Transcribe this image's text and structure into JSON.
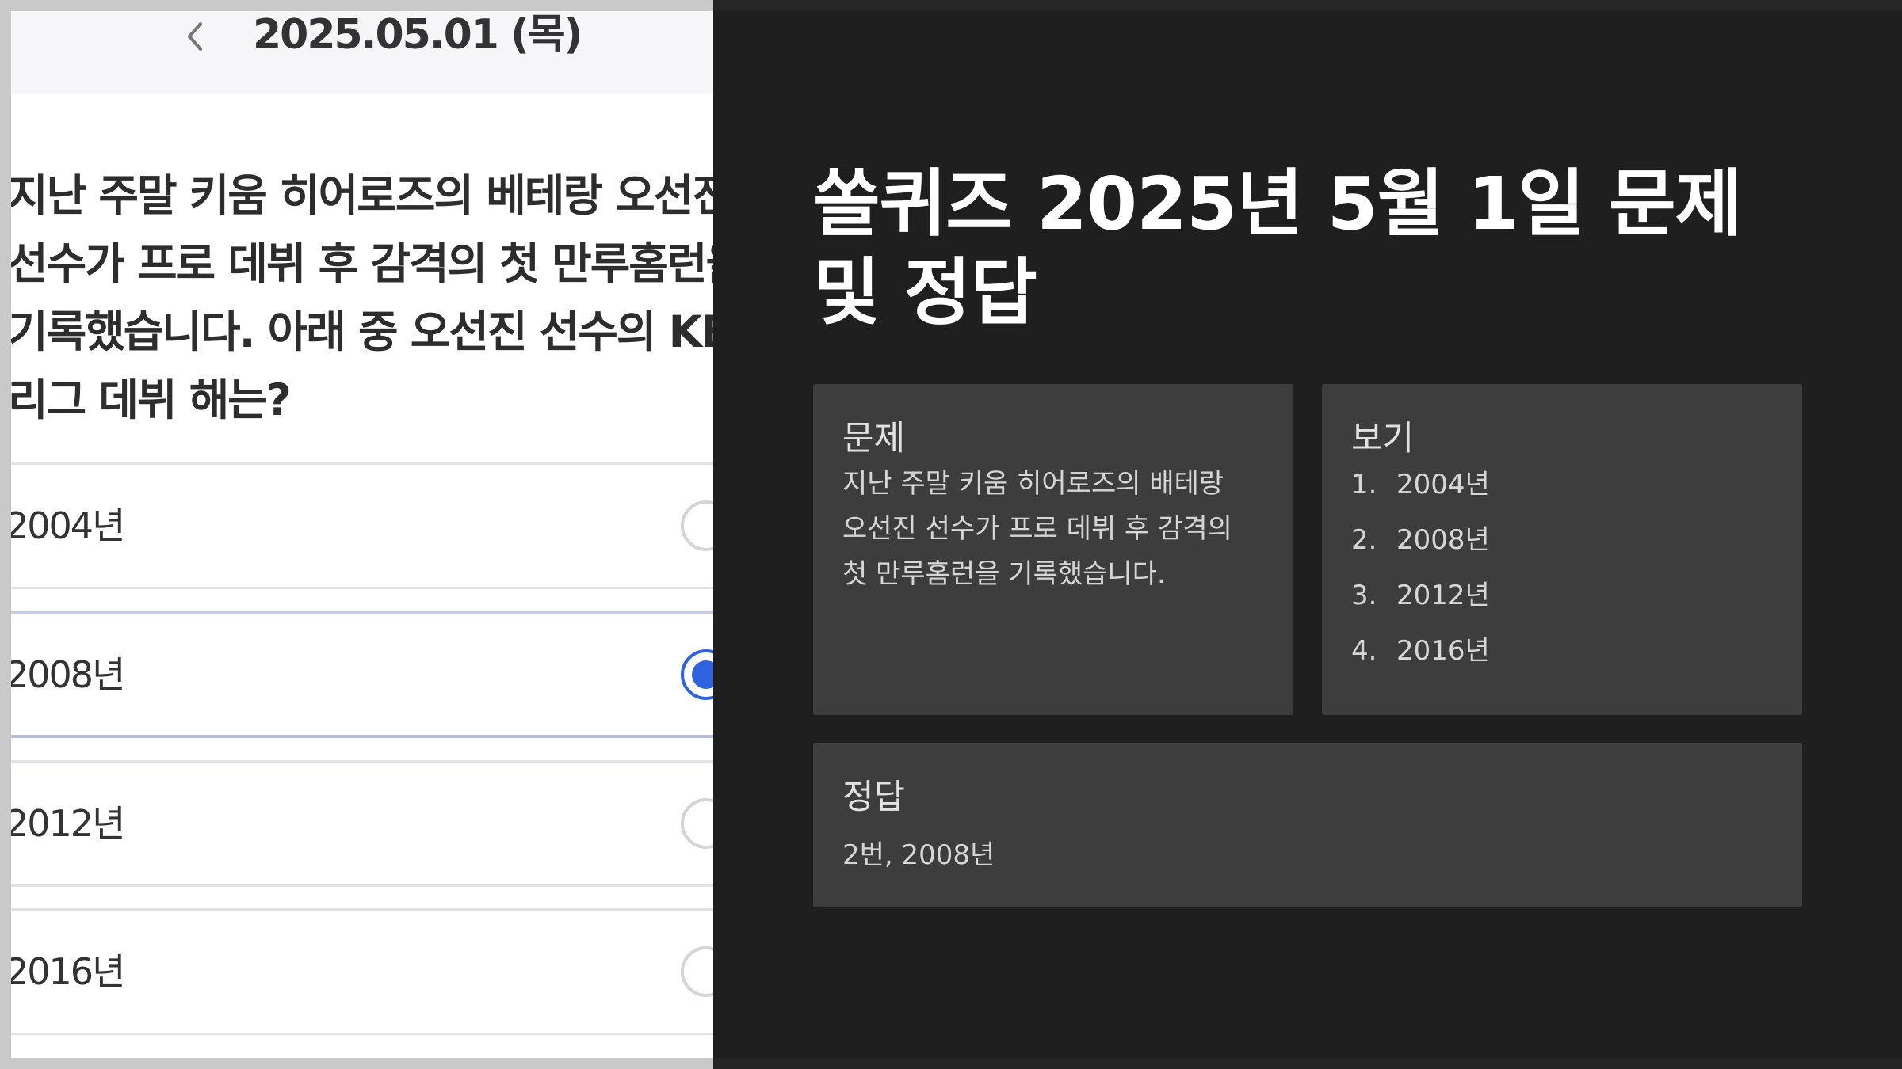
{
  "phone": {
    "header_date": "2025.05.01 (목)",
    "question_lines": [
      "지난 주말 키움 히어로즈의 베테랑 오선진",
      "선수가 프로 데뷔 후 감격의 첫 만루홈런을",
      "기록했습니다. 아래 중 오선진 선수의 KBO",
      "리그 데뷔 해는?"
    ],
    "options": [
      {
        "label": "2004년",
        "selected": false
      },
      {
        "label": "2008년",
        "selected": true
      },
      {
        "label": "2012년",
        "selected": false
      },
      {
        "label": "2016년",
        "selected": false
      }
    ],
    "accent_color": "#2f63e0"
  },
  "article": {
    "title": "쏠퀴즈 2025년 5월 1일 문제 및 정답",
    "question_card": {
      "heading": "문제",
      "body_lines": [
        "지난 주말 키움 히어로즈의 배테랑",
        "오선진 선수가 프로 데뷔 후 감격의",
        "첫 만루홈런을 기록했습니다."
      ]
    },
    "choices_card": {
      "heading": "보기",
      "items": [
        {
          "num": "1.",
          "text": "2004년"
        },
        {
          "num": "2.",
          "text": "2008년"
        },
        {
          "num": "3.",
          "text": "2012년"
        },
        {
          "num": "4.",
          "text": "2016년"
        }
      ]
    },
    "answer_card": {
      "heading": "정답",
      "text": "2번, 2008년"
    },
    "colors": {
      "background": "#1f1f1f",
      "card": "#3d3d3d",
      "title": "#ffffff"
    }
  }
}
